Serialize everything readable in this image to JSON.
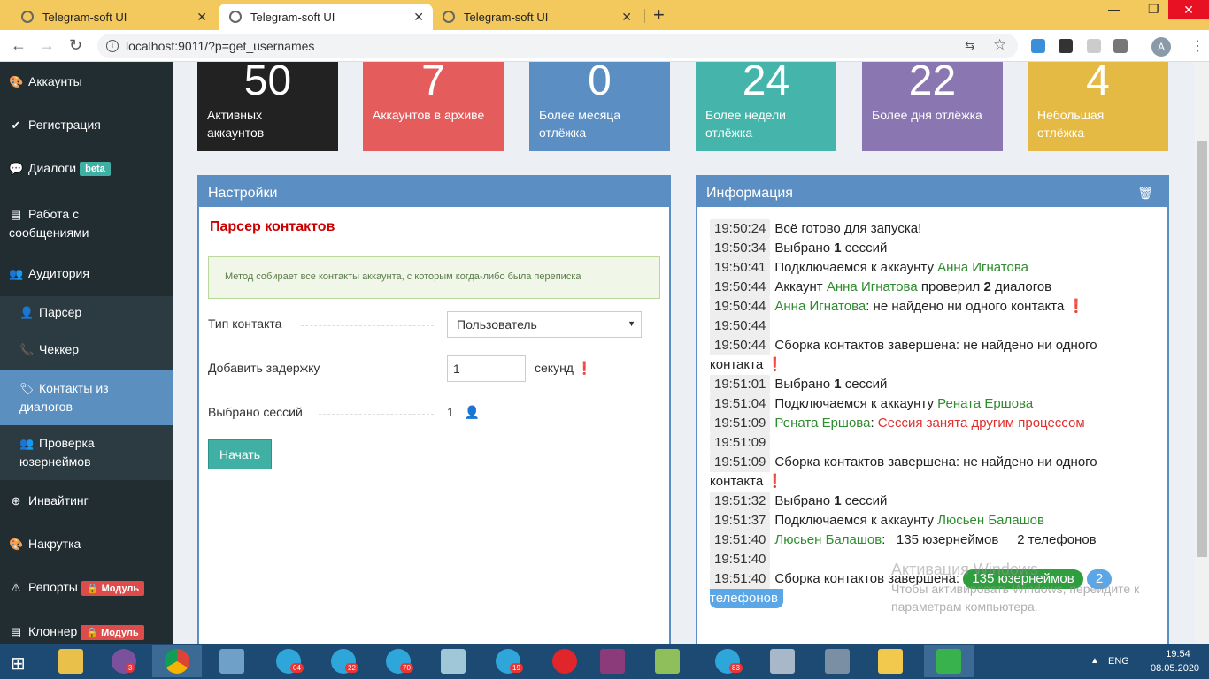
{
  "browser": {
    "tabs": [
      {
        "title": "Telegram-soft UI",
        "active": false
      },
      {
        "title": "Telegram-soft UI",
        "active": true
      },
      {
        "title": "Telegram-soft UI",
        "active": false
      }
    ],
    "url": "localhost:9011/?p=get_usernames",
    "avatar_letter": "A"
  },
  "sidebar": {
    "items": [
      {
        "label": "Аккаунты",
        "icon": "palette-icon"
      },
      {
        "label": "Регистрация",
        "icon": "check-circle-icon"
      },
      {
        "label": "Диалоги",
        "icon": "chat-bubble-icon",
        "badge": "beta"
      },
      {
        "label": "Работа с сообщениями",
        "icon": "list-icon"
      },
      {
        "label": "Аудитория",
        "icon": "users-icon"
      },
      {
        "label": "Парсер",
        "icon": "user-icon"
      },
      {
        "label": "Чеккер",
        "icon": "phone-icon"
      },
      {
        "label": "Контакты из диалогов",
        "icon": "tags-icon",
        "active": true
      },
      {
        "label": "Проверка юзернеймов",
        "icon": "group-icon"
      },
      {
        "label": "Инвайтинг",
        "icon": "plus-circle-icon"
      },
      {
        "label": "Накрутка",
        "icon": "palette-icon"
      },
      {
        "label": "Репорты",
        "icon": "warning-icon",
        "badge": "🔒 Модуль"
      },
      {
        "label": "Клоннер",
        "icon": "list-icon",
        "badge": "🔒 Модуль"
      }
    ]
  },
  "stats": [
    {
      "value": "50",
      "label": "Активных аккаунтов",
      "color": "#222222"
    },
    {
      "value": "7",
      "label": "Аккаунтов в архиве",
      "color": "#e55c5c"
    },
    {
      "value": "0",
      "label": "Более месяца отлёжка",
      "color": "#5b8ec3"
    },
    {
      "value": "24",
      "label": "Более недели отлёжка",
      "color": "#45b5ab"
    },
    {
      "value": "22",
      "label": "Более дня отлёжка",
      "color": "#8a76b0"
    },
    {
      "value": "4",
      "label": "Небольшая отлёжка",
      "color": "#e4b944"
    }
  ],
  "settings": {
    "title": "Настройки",
    "section_title": "Парсер контактов",
    "alert": "Метод собирает все контакты аккаунта, с которым когда-либо была переписка",
    "contact_type_label": "Тип контакта",
    "contact_type_value": "Пользователь",
    "delay_label": "Добавить задержку",
    "delay_value": "1",
    "delay_unit": "секунд",
    "sessions_label": "Выбрано сессий",
    "sessions_value": "1",
    "start_button": "Начать"
  },
  "info": {
    "title": "Информация",
    "log": [
      {
        "ts": "19:50:24",
        "parts": [
          {
            "t": "Всё готово для запуска!"
          }
        ]
      },
      {
        "ts": "19:50:34",
        "parts": [
          {
            "t": "Выбрано "
          },
          {
            "t": "1",
            "b": true
          },
          {
            "t": " сессий"
          }
        ]
      },
      {
        "ts": "19:50:41",
        "parts": [
          {
            "t": "Подключаемся к аккаунту "
          },
          {
            "t": "Анна Игнатова",
            "c": "gn"
          }
        ]
      },
      {
        "ts": "19:50:44",
        "parts": [
          {
            "t": "Аккаунт "
          },
          {
            "t": "Анна Игнатова",
            "c": "gn"
          },
          {
            "t": " проверил "
          },
          {
            "t": "2",
            "b": true
          },
          {
            "t": " диалогов"
          }
        ]
      },
      {
        "ts": "19:50:44",
        "parts": [
          {
            "t": "Анна Игнатова",
            "c": "gn"
          },
          {
            "t": ": не найдено ни одного контакта "
          },
          {
            "t": "❗"
          }
        ]
      },
      {
        "ts": "19:50:44",
        "parts": []
      },
      {
        "ts": "19:50:44",
        "parts": [
          {
            "t": "Сборка контактов завершена: не найдено ни одного"
          }
        ],
        "wrap": "контакта ❗"
      },
      {
        "ts": "19:51:01",
        "parts": [
          {
            "t": "Выбрано "
          },
          {
            "t": "1",
            "b": true
          },
          {
            "t": " сессий"
          }
        ]
      },
      {
        "ts": "19:51:04",
        "parts": [
          {
            "t": "Подключаемся к аккаунту "
          },
          {
            "t": "Рената Ершова",
            "c": "gn"
          }
        ]
      },
      {
        "ts": "19:51:09",
        "parts": [
          {
            "t": "Рената Ершова",
            "c": "gn"
          },
          {
            "t": ": "
          },
          {
            "t": "Сессия занята другим процессом",
            "c": "rd"
          }
        ]
      },
      {
        "ts": "19:51:09",
        "parts": []
      },
      {
        "ts": "19:51:09",
        "parts": [
          {
            "t": "Сборка контактов завершена: не найдено ни одного"
          }
        ],
        "wrap": "контакта ❗"
      },
      {
        "ts": "19:51:32",
        "parts": [
          {
            "t": "Выбрано "
          },
          {
            "t": "1",
            "b": true
          },
          {
            "t": " сессий"
          }
        ]
      },
      {
        "ts": "19:51:37",
        "parts": [
          {
            "t": "Подключаемся к аккаунту "
          },
          {
            "t": "Люсьен Балашов",
            "c": "gn"
          }
        ]
      },
      {
        "ts": "19:51:40",
        "parts": [
          {
            "t": "Люсьен Балашов",
            "c": "gn"
          },
          {
            "t": ":   "
          },
          {
            "t": "135 юзернеймов",
            "c": "ul"
          },
          {
            "t": "     "
          },
          {
            "t": "2 телефонов",
            "c": "ul"
          }
        ]
      },
      {
        "ts": "19:51:40",
        "parts": []
      },
      {
        "ts": "19:51:40",
        "parts": [
          {
            "t": "Сборка контактов завершена: "
          },
          {
            "t": "135 юзернеймов",
            "c": "pill",
            "bg": "#2e9e3e"
          },
          {
            "t": " "
          },
          {
            "t": "2",
            "c": "pill",
            "bg": "#5aa6e6"
          }
        ],
        "wrap_pill": "телефонов"
      }
    ]
  },
  "watermark": {
    "title": "Активация Windows",
    "line1": "Чтобы активировать Windows, перейдите к",
    "line2": "параметрам компьютера."
  },
  "taskbar": {
    "badges": [
      "3",
      "04",
      "22",
      "70",
      "19",
      "83"
    ],
    "lang": "ENG",
    "time": "19:54",
    "date": "08.05.2020"
  }
}
